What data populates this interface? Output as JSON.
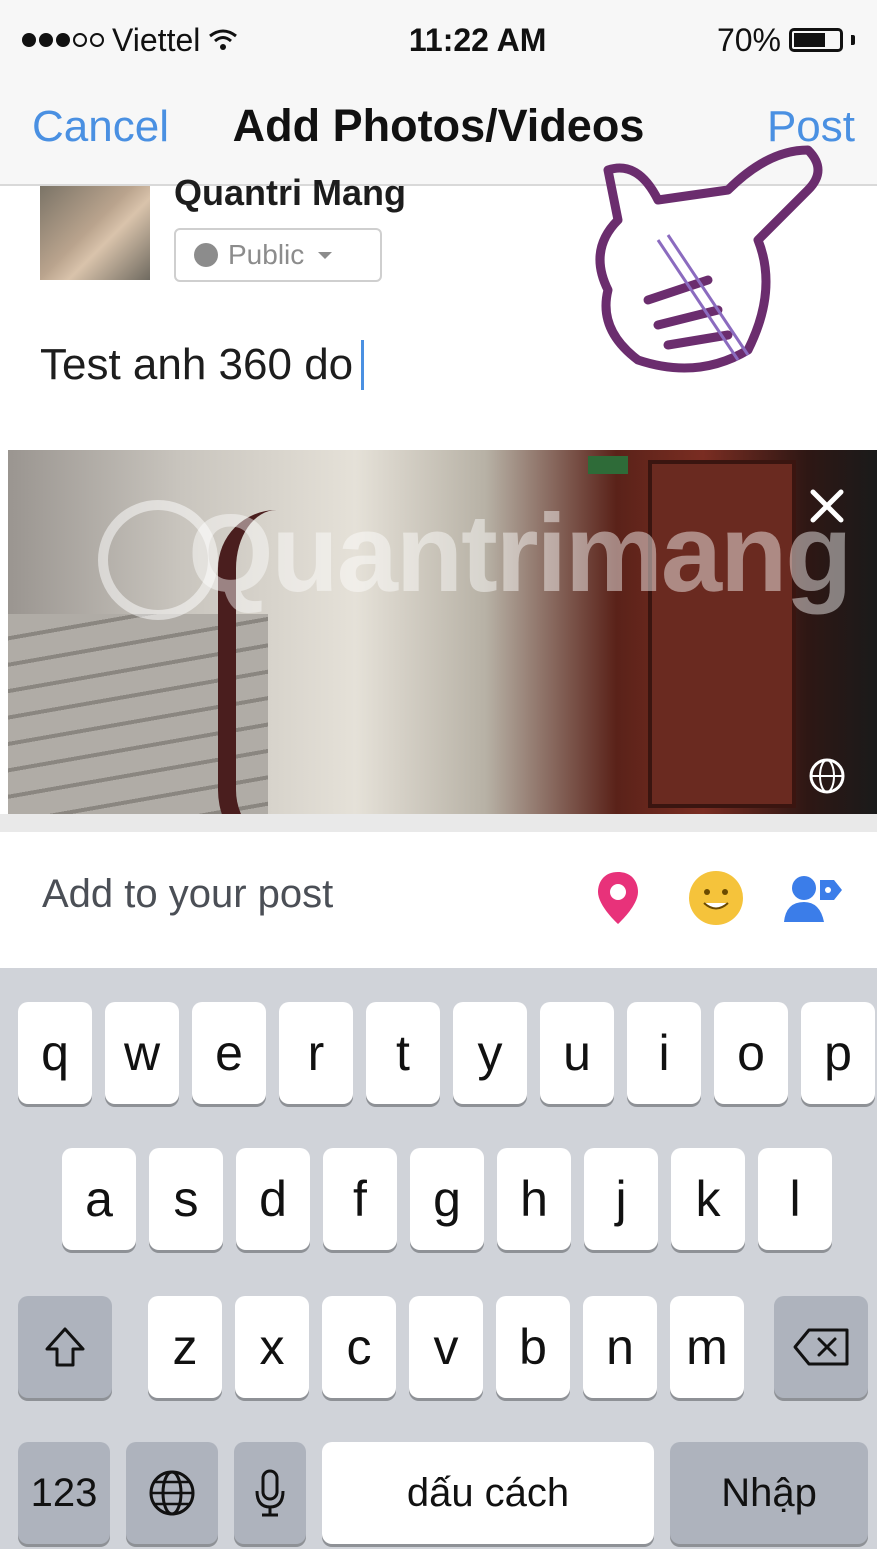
{
  "status": {
    "carrier": "Viettel",
    "time": "11:22 AM",
    "battery_text": "70%",
    "battery_level": 0.7
  },
  "nav": {
    "cancel": "Cancel",
    "title": "Add Photos/Videos",
    "post": "Post"
  },
  "composer": {
    "user_name": "Quantri Mang",
    "privacy": "Public",
    "text": "Test anh 360 do"
  },
  "photo": {
    "watermark": "Quantrimang"
  },
  "add_to_post": {
    "label": "Add to your post",
    "icons": [
      "location-pin-icon",
      "feeling-emoji-icon",
      "tag-friends-icon"
    ]
  },
  "keyboard": {
    "row1": [
      "q",
      "w",
      "e",
      "r",
      "t",
      "y",
      "u",
      "i",
      "o",
      "p"
    ],
    "row2": [
      "a",
      "s",
      "d",
      "f",
      "g",
      "h",
      "j",
      "k",
      "l"
    ],
    "row3": [
      "z",
      "x",
      "c",
      "v",
      "b",
      "n",
      "m"
    ],
    "numbers": "123",
    "space": "dấu cách",
    "return": "Nhập"
  },
  "colors": {
    "accent": "#4a90e2",
    "location": "#e8327a",
    "feeling": "#f5c33b",
    "tag": "#3b7de9",
    "annotation": "#6b2d6e"
  }
}
